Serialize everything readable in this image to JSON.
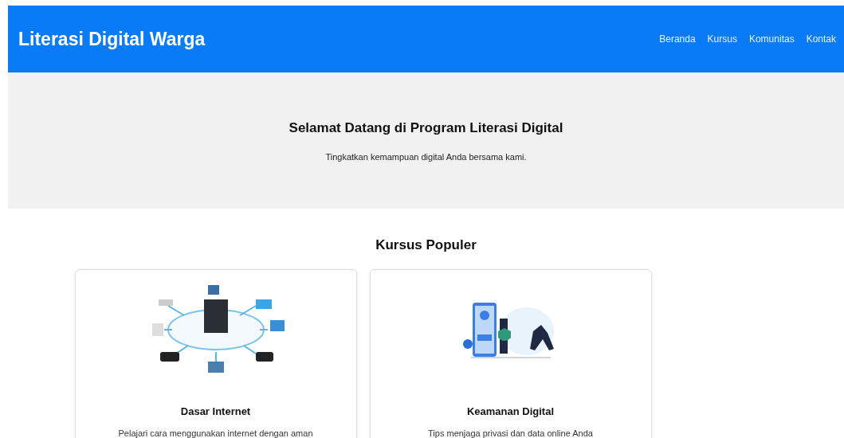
{
  "header": {
    "title": "Literasi Digital Warga",
    "nav": [
      "Beranda",
      "Kursus",
      "Komunitas",
      "Kontak"
    ]
  },
  "hero": {
    "title": "Selamat Datang di Program Literasi Digital",
    "subtitle": "Tingkatkan kemampuan digital Anda bersama kami."
  },
  "courses": {
    "title": "Kursus Populer",
    "items": [
      {
        "kind": "network",
        "title": "Dasar Internet",
        "description": "Pelajari cara menggunakan internet dengan aman"
      },
      {
        "kind": "security",
        "title": "Keamanan Digital",
        "description": "Tips menjaga privasi dan data online Anda"
      }
    ]
  }
}
